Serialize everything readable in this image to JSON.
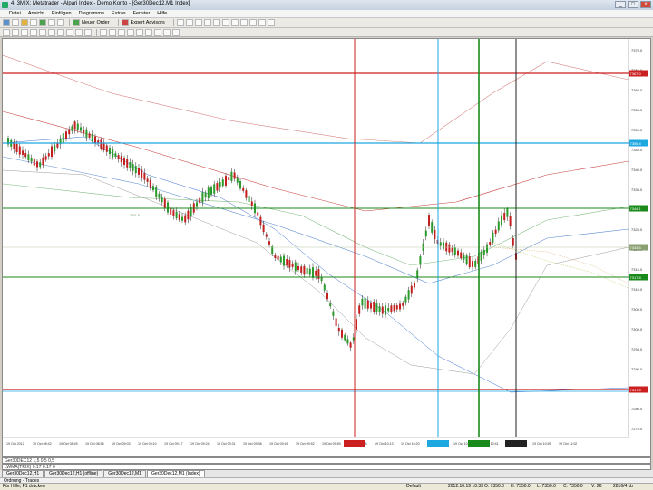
{
  "window": {
    "title": "4: 3MIX: Metatrader - Alpari Index - Demo Konto - [Ger30Dec12,M1 Index]",
    "buttons": [
      "_",
      "□",
      "×"
    ]
  },
  "menu": [
    "Datei",
    "Ansicht",
    "Einfügen",
    "Diagramme",
    "Extras",
    "Fenster",
    "Hilfe"
  ],
  "toolbar": {
    "new_order_label": "Neuer Order",
    "expert_label": "Expert Advisors"
  },
  "chart": {
    "price_labels": [
      "7370.0",
      "7365.0",
      "7360.0",
      "7355.0",
      "7350.0",
      "7345.0",
      "7340.0",
      "7335.0",
      "7330.0",
      "7325.0",
      "7320.0",
      "7315.0",
      "7310.0",
      "7305.0",
      "7300.0",
      "7295.0",
      "7290.0",
      "7285.0",
      "7280.0",
      "7275.0"
    ],
    "time_labels": [
      "19 Oct 2012",
      "19 Oct 08:42",
      "19 Oct 08:49",
      "19 Oct 08:56",
      "19 Oct 09:03",
      "19 Oct 09:10",
      "19 Oct 09:17",
      "19 Oct 09:24",
      "19 Oct 09:31",
      "19 Oct 09:38",
      "19 Oct 09:45",
      "19 Oct 09:52",
      "19 Oct 09:59",
      "19 Oct 10:06",
      "19 Oct 10:13",
      "19 Oct 10:20",
      "19 Oct 10:27",
      "19 Oct 10:34",
      "19 Oct 10:41",
      "19 Oct 10:48",
      "19 Oct 10:55",
      "19 Oct 11:02"
    ],
    "line_labels": [
      "7367.0",
      "7355.4",
      "7344.1",
      "7343.6",
      "7317.8",
      "7317.5"
    ],
    "marker_labels": [
      "7341.8"
    ]
  },
  "indicators": {
    "line1": "Ger30DEC12 1,5 0,5 0,5",
    "line2": "LWMA(TRIX) 0.17 0.17 0"
  },
  "tabs": [
    "Ger30Dec12,H1",
    "Ger30Dec12,H1 (offline)",
    "Ger30Dec12,M1",
    "Ger30Dec12,M1 (Index)"
  ],
  "panel": {
    "label": "Ordnung · Trades"
  },
  "status": {
    "help": "Für Hilfe, F1 drücken",
    "profile": "Default",
    "datetime": "2012.10.19 10:33",
    "open": "O: 7350.0",
    "high": "H: 7350.0",
    "low": "L: 7350.0",
    "close": "C: 7350.0",
    "volume": "V: 26",
    "traffic": "2816/4 kb"
  },
  "colors": {
    "red_line": "#cc1f1f",
    "blue_line": "#1ea8e0",
    "green_line": "#1a8a1a",
    "black_line": "#222222"
  }
}
